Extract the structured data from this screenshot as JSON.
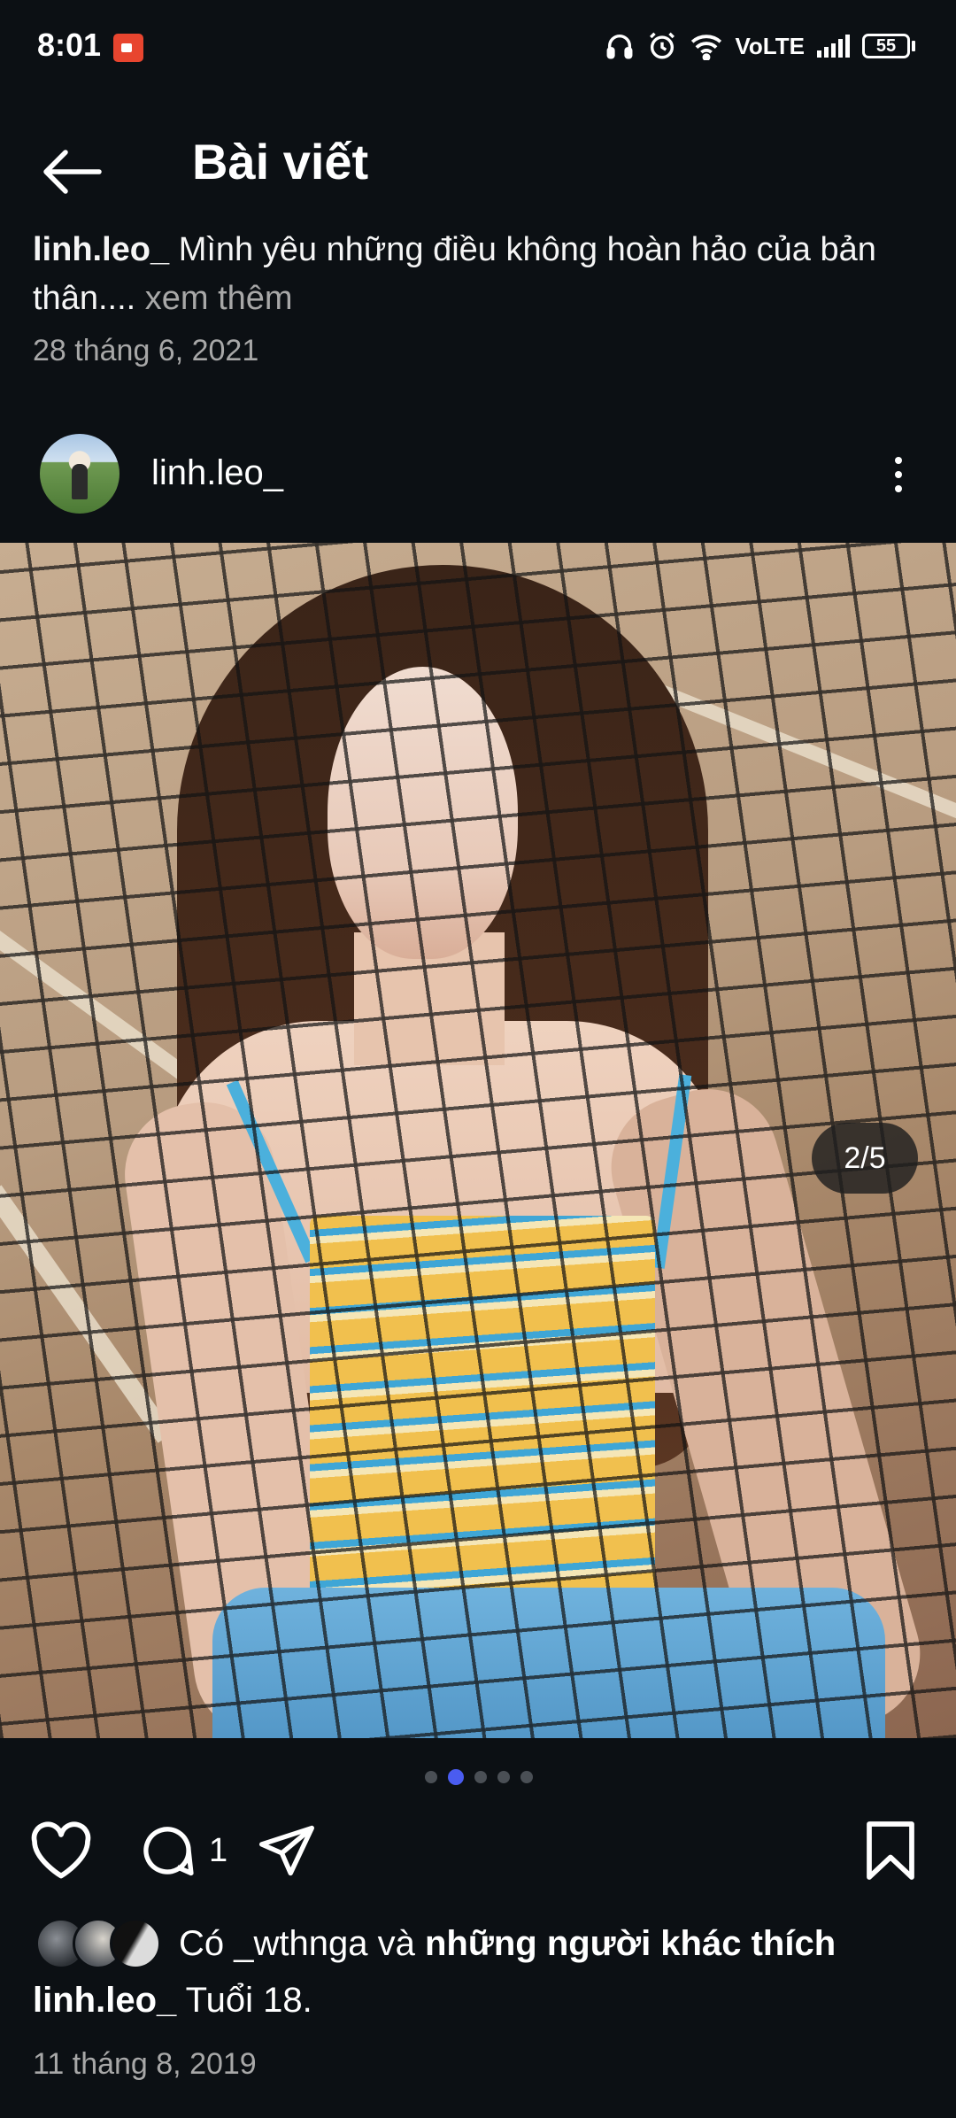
{
  "status_bar": {
    "time": "8:01",
    "network": "VoLTE",
    "battery": "55"
  },
  "header": {
    "title": "Bài viết"
  },
  "previous_post": {
    "username": "linh.leo_",
    "caption": "Mình yêu những điều không hoàn hảo của bản thân....",
    "more_label": "xem thêm",
    "date": "28 tháng 6, 2021"
  },
  "post": {
    "username": "linh.leo_",
    "carousel_counter": "2/5",
    "carousel_current": 2,
    "carousel_total": 5,
    "comment_count": "1",
    "likes": {
      "prefix": "Có",
      "first_liker": "_wthnga",
      "connector": "và",
      "others": "những người khác thích"
    },
    "caption_username": "linh.leo_",
    "caption_text": "Tuổi 18.",
    "date": "11 tháng 8, 2019"
  },
  "icons": {
    "back": "arrow-left-icon",
    "more": "more-vertical-icon",
    "like": "heart-icon",
    "comment": "comment-icon",
    "share": "send-icon",
    "save": "bookmark-icon"
  },
  "colors": {
    "background": "#0c1014",
    "text_secondary": "#a8a8a8",
    "carousel_active_dot": "#4a5cf0"
  }
}
